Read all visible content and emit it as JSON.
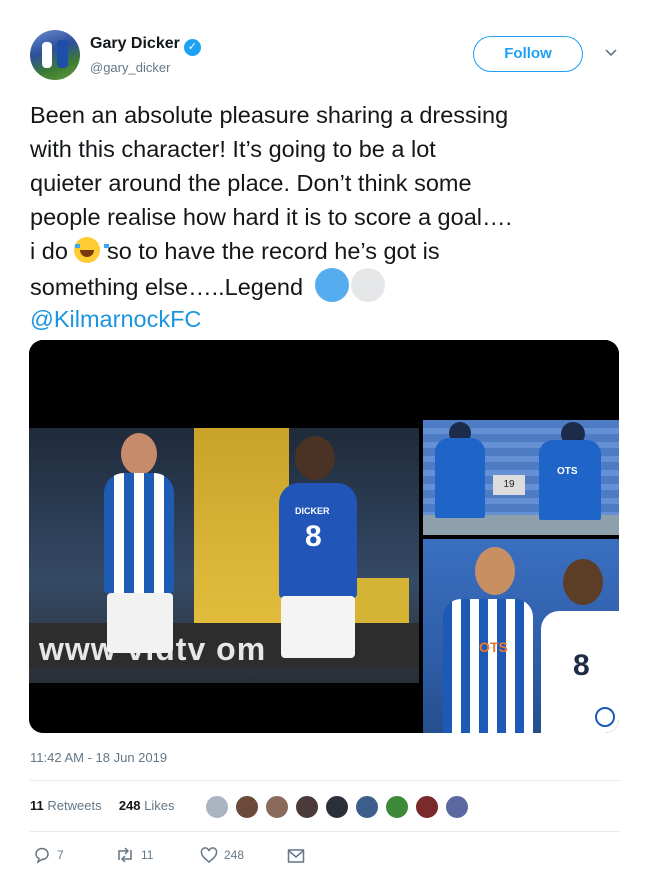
{
  "author": {
    "name": "Gary Dicker",
    "handle": "@gary_dicker",
    "verified_icon": "verified-badge-icon"
  },
  "follow_label": "Follow",
  "tweet": {
    "lines": [
      "Been an absolute pleasure sharing a dressing",
      "with this character! It’s going to be a lot",
      "quieter around the place. Don’t think some",
      "people realise how hard it is to score a goal….",
      "so to have the record he’s got is",
      "something else…..Legend"
    ],
    "line5_prefix": "i do",
    "mention": "@KilmarnockFC"
  },
  "media": {
    "board_text": "www   vidtv   om",
    "player_back_name": "DICKER",
    "player_back_number": "8",
    "sign_number": "19",
    "sponsor": "OTS",
    "sponsor_bottom": "OTS",
    "shirt_number_bottom": "8"
  },
  "timestamp": "11:42 AM - 18 Jun 2019",
  "stats": {
    "retweets_count": "11",
    "retweets_label": "Retweets",
    "likes_count": "248",
    "likes_label": "Likes"
  },
  "liker_colors": [
    "#a9b4c0",
    "#6b4a3a",
    "#8a6a5a",
    "#4b3a3a",
    "#2a2f3a",
    "#3d5e8a",
    "#3f8a3a",
    "#7a2a2a",
    "#5a6aa0"
  ],
  "actions": {
    "reply_count": "7",
    "retweet_count": "11",
    "like_count": "248"
  },
  "colors": {
    "accent": "#1da1f2",
    "mention": "#1b95e0",
    "muted": "#657786"
  }
}
